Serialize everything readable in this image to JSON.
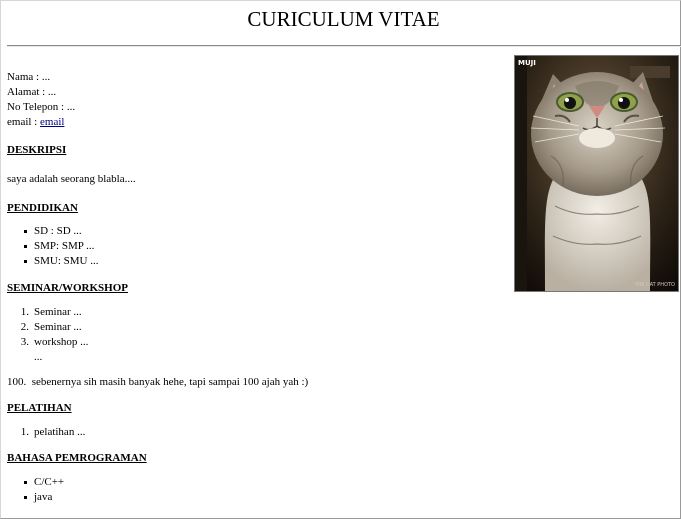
{
  "page": {
    "title": "CURICULUM VITAE"
  },
  "info": {
    "nama": "Nama : ...",
    "alamat": "Alamat : ...",
    "telepon": "No Telepon : ...",
    "email_label": "email : ",
    "email_link": "email"
  },
  "deskripsi": {
    "heading": "DESKRIPSI",
    "text": "saya adalah seorang blabla...."
  },
  "pendidikan": {
    "heading": "PENDIDIKAN",
    "items": [
      "SD : SD ...",
      "SMP: SMP ...",
      "SMU: SMU ..."
    ]
  },
  "seminar": {
    "heading": "SEMINAR/WORKSHOP",
    "items": [
      {
        "num": "1.",
        "text": "Seminar ..."
      },
      {
        "num": "2.",
        "text": "Seminar ..."
      },
      {
        "num": "3.",
        "text": "workshop ..."
      }
    ],
    "ellipsis": "...",
    "last_num": "100.",
    "last_text": "sebenernya sih masih banyak hehe, tapi sampai 100 ajah yah :)"
  },
  "pelatihan": {
    "heading": "PELATIHAN",
    "items": [
      {
        "num": "1.",
        "text": "pelatihan ..."
      }
    ]
  },
  "bahasa": {
    "heading": "BAHASA PEMROGRAMAN",
    "items": [
      "C/C++",
      "java"
    ]
  },
  "photo": {
    "caption_top": "MUJI",
    "caption_bottom": "THE CAT PHOTO",
    "subject": "cat-photo"
  }
}
